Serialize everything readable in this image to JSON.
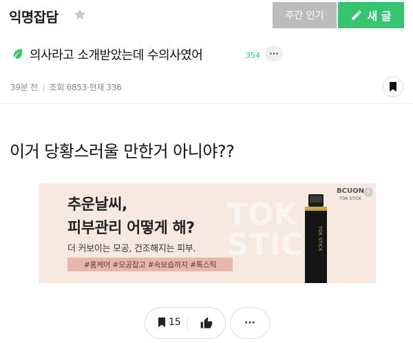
{
  "header": {
    "board_title": "익명잡담",
    "weekly_popular_label": "주간 인기",
    "write_label": "새 글"
  },
  "post": {
    "title": "의사라고 소개받았는데 수의사였어",
    "comment_count": "354",
    "more_label": "···",
    "meta": {
      "time_ago": "39분 전",
      "views": "조회 6853",
      "current": "현재 336"
    },
    "body": "이거 당황스러울 만한거 아니야??"
  },
  "ad": {
    "headline_line1": "추운날씨,",
    "headline_line2": "피부관리 어떻게 해?",
    "subtext": "더 커보이는 모공, 건조해지는 피부.",
    "tags": "#홈케어 #모공잡고 #속보습까지 #톡스틱",
    "brand": "BCUON",
    "brand_sub": "TOK STICK",
    "background_text": "TOK STICK",
    "device_text": "TOK STICK"
  },
  "actions": {
    "bookmark_count": "15",
    "more_label": "···"
  },
  "colors": {
    "accent": "#35c46f",
    "weekly_button": "#bcbcbc",
    "ad_background": "#f7e8e0",
    "ad_tag_background": "#e7b7ad"
  }
}
